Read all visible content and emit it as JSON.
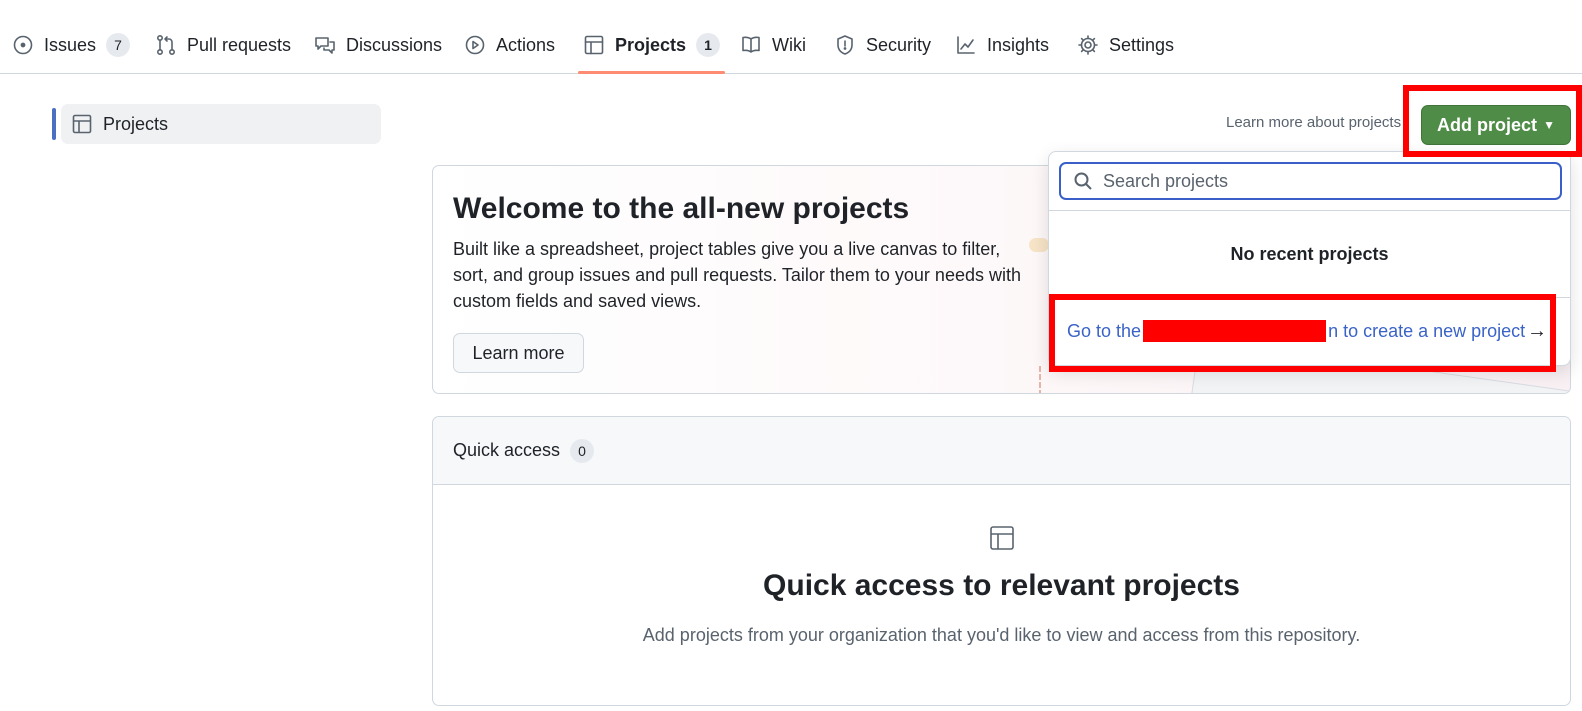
{
  "tabs": [
    {
      "label": "Issues",
      "count": "7",
      "icon": "issue-opened-icon"
    },
    {
      "label": "Pull requests",
      "icon": "pull-request-icon"
    },
    {
      "label": "Discussions",
      "icon": "discussions-icon"
    },
    {
      "label": "Actions",
      "icon": "play-icon"
    },
    {
      "label": "Projects",
      "count": "1",
      "icon": "table-icon",
      "selected": true
    },
    {
      "label": "Wiki",
      "icon": "book-icon"
    },
    {
      "label": "Security",
      "icon": "shield-icon"
    },
    {
      "label": "Insights",
      "icon": "graph-icon"
    },
    {
      "label": "Settings",
      "icon": "gear-icon"
    }
  ],
  "sidebar": {
    "items": [
      {
        "label": "Projects",
        "icon": "table-icon",
        "selected": true
      }
    ]
  },
  "header": {
    "learn_more_link": "Learn more about projects",
    "add_project_label": "Add project"
  },
  "banner": {
    "title": "Welcome to the all-new projects",
    "description": "Built like a spreadsheet, project tables give you a live canvas to filter, sort, and group issues and pull requests. Tailor them to your needs with custom fields and saved views.",
    "learn_more_button": "Learn more"
  },
  "dropdown": {
    "search_placeholder": "Search projects",
    "no_recent": "No recent projects",
    "goto_prefix": "Go to the",
    "goto_suffix": "n to create a new project"
  },
  "quick_access": {
    "title": "Quick access",
    "count": "0",
    "heading": "Quick access to relevant projects",
    "description": "Add projects from your organization that you'd like to view and access from this repository."
  },
  "colors": {
    "primary_button": "#4f8c47",
    "selected_tab_underline": "#fd8c73",
    "link": "#3a63c7",
    "annotation_red": "#ff0000"
  }
}
